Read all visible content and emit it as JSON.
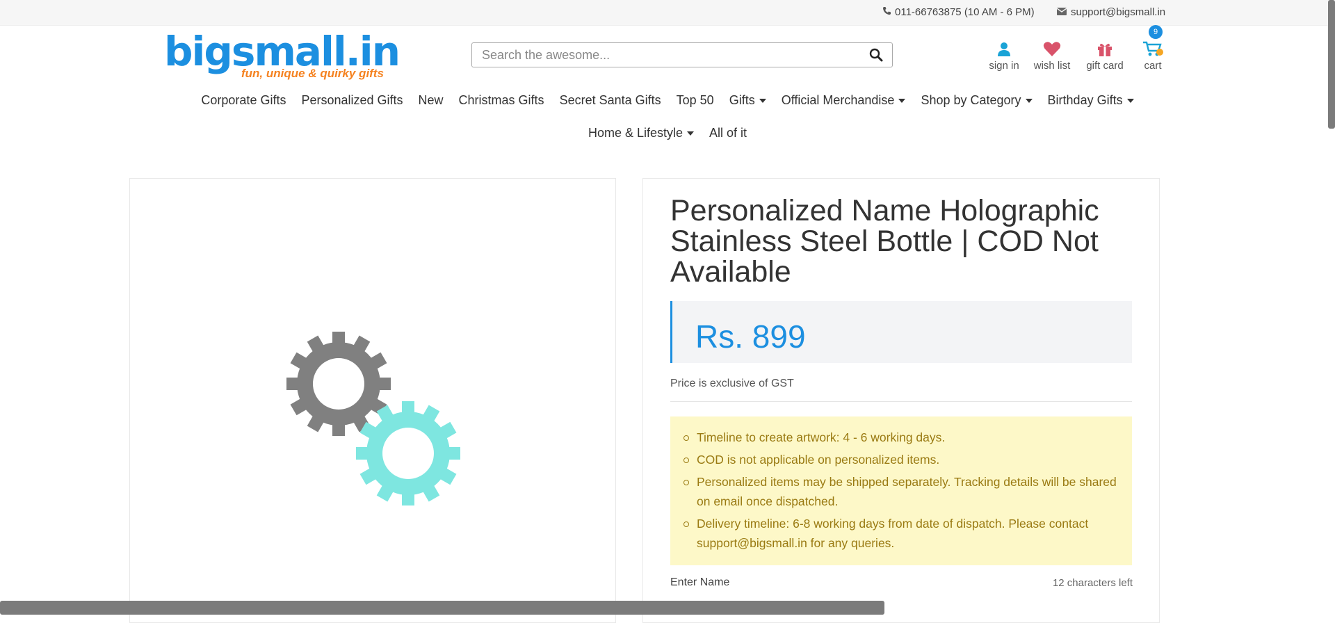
{
  "topbar": {
    "phone": "011-66763875 (10 AM - 6 PM)",
    "email": "support@bigsmall.in"
  },
  "logo": {
    "name": "bigsmall.in",
    "tagline": "fun, unique & quirky gifts"
  },
  "search": {
    "placeholder": "Search the awesome..."
  },
  "header_links": {
    "signin": "sign in",
    "wishlist": "wish list",
    "giftcard": "gift card",
    "cart": "cart",
    "cart_count": "9"
  },
  "nav": {
    "row1": [
      "Corporate Gifts",
      "Personalized Gifts",
      "New",
      "Christmas Gifts",
      "Secret Santa Gifts",
      "Top 50",
      "Gifts",
      "Official Merchandise",
      "Shop by Category",
      "Birthday Gifts"
    ],
    "row2": [
      "Home & Lifestyle",
      "All of it"
    ]
  },
  "product": {
    "title": "Personalized Name Holographic Stainless Steel Bottle | COD Not Available",
    "price": "Rs. 899",
    "gst_note": "Price is exclusive of GST",
    "notices": [
      "Timeline to create artwork: 4 - 6 working days.",
      "COD is not applicable on personalized items.",
      "Personalized items may be shipped separately. Tracking details will be shared on email once dispatched.",
      "Delivery timeline: 6-8 working days from date of dispatch. Please contact support@bigsmall.in for any queries."
    ],
    "name_field_label": "Enter Name",
    "name_field_count": "12 characters left"
  },
  "colors": {
    "brand_blue": "#1c8fe0",
    "brand_orange": "#f58220",
    "gear_gray": "#808080",
    "gear_teal": "#7ee6e0",
    "notice_bg": "#fdf8c8",
    "notice_text": "#9a7a12"
  }
}
